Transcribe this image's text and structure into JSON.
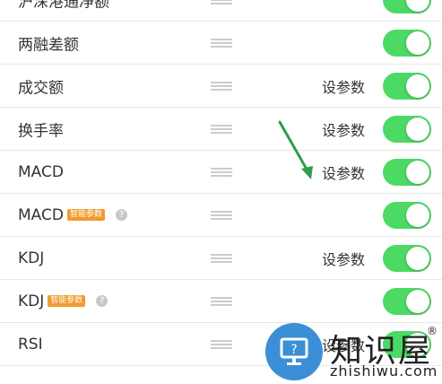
{
  "rows": [
    {
      "label": "沪深港通净额",
      "badge": "",
      "params": ""
    },
    {
      "label": "两融差额",
      "badge": "",
      "params": ""
    },
    {
      "label": "成交额",
      "badge": "",
      "params": "设参数"
    },
    {
      "label": "换手率",
      "badge": "",
      "params": "设参数"
    },
    {
      "label": "MACD",
      "badge": "",
      "params": "设参数"
    },
    {
      "label": "MACD",
      "badge": "智能参数",
      "params": ""
    },
    {
      "label": "KDJ",
      "badge": "",
      "params": "设参数"
    },
    {
      "label": "KDJ",
      "badge": "智能参数",
      "params": ""
    },
    {
      "label": "RSI",
      "badge": "",
      "params": "设参数"
    }
  ],
  "help_glyph": "?",
  "colors": {
    "toggle_on": "#4cd964",
    "badge": "#f29a2e",
    "arrow": "#2e9e4f",
    "watermark": "#3b8fd6"
  },
  "watermark": {
    "title": "知识屋",
    "reg": "®",
    "domain": "zhishiwu.com"
  }
}
